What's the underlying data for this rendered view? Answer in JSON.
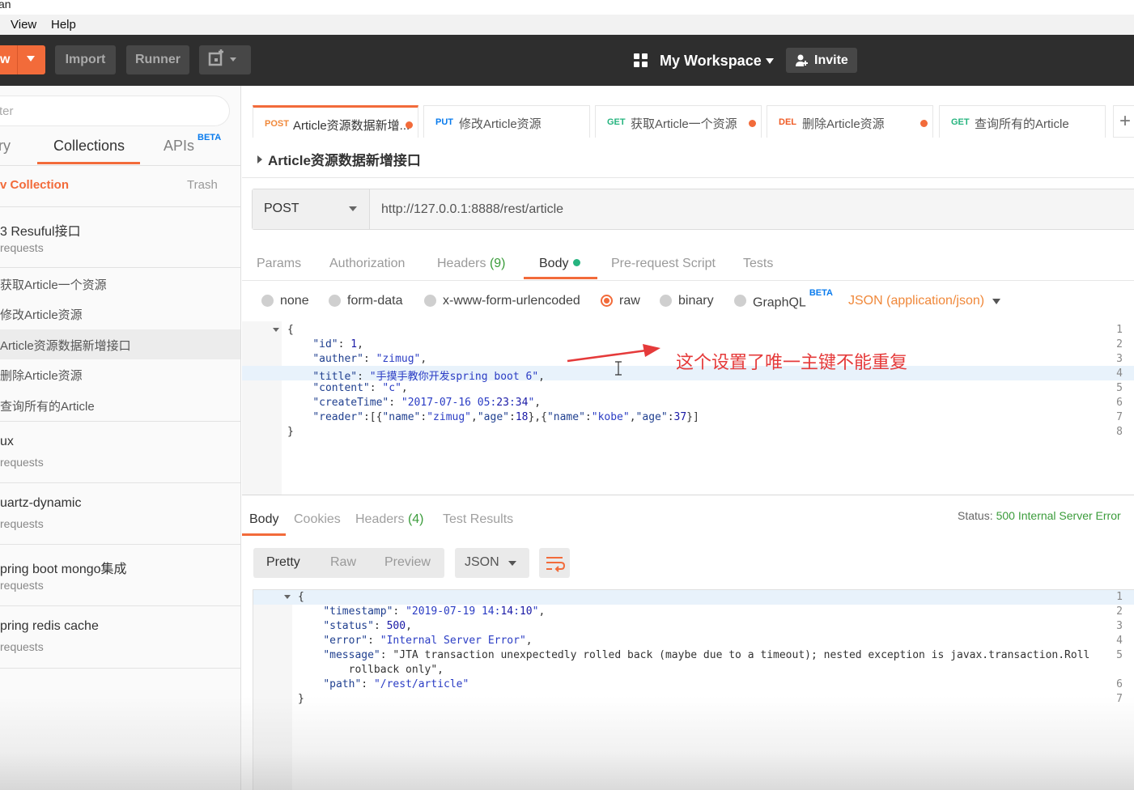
{
  "window": {
    "title_fragment": "an"
  },
  "menu": {
    "items": [
      "View",
      "Help"
    ]
  },
  "header": {
    "new_label": "w",
    "import_label": "Import",
    "runner_label": "Runner",
    "workspace_label": "My Workspace",
    "invite_label": "Invite"
  },
  "sidebar": {
    "search_placeholder": "ter",
    "tabs": {
      "history": "ry",
      "collections": "Collections",
      "apis": "APIs",
      "apis_badge": "BETA"
    },
    "new_collection": "v Collection",
    "trash": "Trash",
    "collections": [
      {
        "name": "3 Resuful接口",
        "sub": "requests"
      },
      {
        "name": "ux",
        "sub": "requests"
      },
      {
        "name": "uartz-dynamic",
        "sub": "requests"
      },
      {
        "name": "pring boot mongo集成",
        "sub": "requests"
      },
      {
        "name": "pring redis cache",
        "sub": "requests"
      }
    ],
    "requests": [
      "获取Article一个资源",
      "修改Article资源",
      "Article资源数据新增接口",
      "删除Article资源",
      "查询所有的Article"
    ]
  },
  "tabs": [
    {
      "method": "POST",
      "title": "Article资源数据新增...",
      "method_color": "#f0883a",
      "dirty": true
    },
    {
      "method": "PUT",
      "title": "修改Article资源",
      "method_color": "#097bed",
      "dirty": false
    },
    {
      "method": "GET",
      "title": "获取Article一个资源",
      "method_color": "#26b47f",
      "dirty": true
    },
    {
      "method": "DEL",
      "title": "删除Article资源",
      "method_color": "#ef5b25",
      "dirty": true
    },
    {
      "method": "GET",
      "title": "查询所有的Article",
      "method_color": "#26b47f",
      "dirty": false
    }
  ],
  "request": {
    "title": "Article资源数据新增接口",
    "method": "POST",
    "url": "http://127.0.0.1:8888/rest/article",
    "tabs": {
      "params": "Params",
      "authorization": "Authorization",
      "headers": "Headers",
      "headers_count": "(9)",
      "body": "Body",
      "prerequest": "Pre-request Script",
      "tests": "Tests"
    },
    "body_modes": {
      "none": "none",
      "formdata": "form-data",
      "urlencoded": "x-www-form-urlencoded",
      "raw": "raw",
      "binary": "binary",
      "graphql": "GraphQL",
      "graphql_badge": "BETA"
    },
    "content_type": "JSON (application/json)",
    "body_lines": [
      "{",
      "    \"id\": 1,",
      "    \"auther\": \"zimug\",",
      "    \"title\": \"手摸手教你开发spring boot 6\",",
      "    \"content\": \"c\",",
      "    \"createTime\": \"2017-07-16 05:23:34\",",
      "    \"reader\":[{\"name\":\"zimug\",\"age\":18},{\"name\":\"kobe\",\"age\":37}]",
      "}"
    ]
  },
  "annotation": {
    "text": "这个设置了唯一主键不能重复",
    "color": "#e53a3a"
  },
  "response": {
    "tabs": {
      "body": "Body",
      "cookies": "Cookies",
      "headers": "Headers",
      "headers_count": "(4)",
      "tests": "Test Results"
    },
    "status_label": "Status:",
    "status_value": "500 Internal Server Error",
    "views": {
      "pretty": "Pretty",
      "raw": "Raw",
      "preview": "Preview"
    },
    "format": "JSON",
    "body_lines": [
      "{",
      "    \"timestamp\": \"2019-07-19 14:14:10\",",
      "    \"status\": 500,",
      "    \"error\": \"Internal Server Error\",",
      "    \"message\": \"JTA transaction unexpectedly rolled back (maybe due to a timeout); nested exception is javax.transaction.Roll",
      "        rollback only\",",
      "    \"path\": \"/rest/article\"",
      "}"
    ],
    "line_numbers": [
      "1",
      "2",
      "3",
      "4",
      "5",
      "",
      "6",
      "7"
    ]
  },
  "colors": {
    "accent": "#f26b3a",
    "header_bg": "#2e2e2e",
    "status_ok": "#3b9c3b"
  }
}
